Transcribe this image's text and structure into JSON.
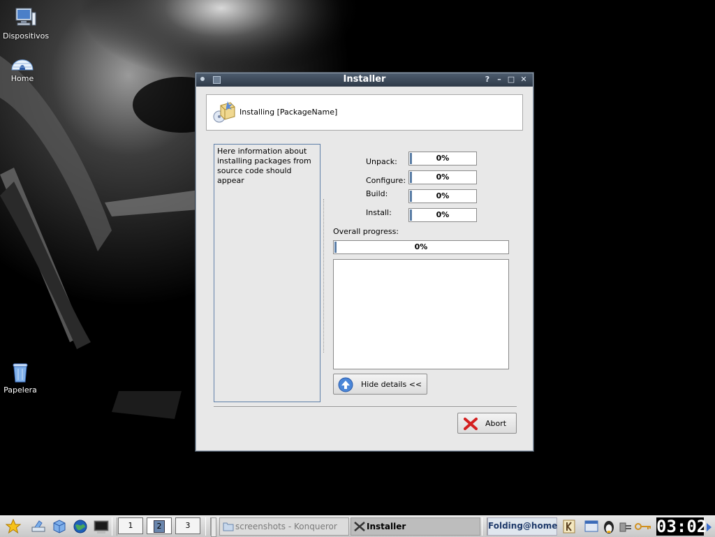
{
  "desktop": {
    "icons": [
      {
        "label": "Dispositivos"
      },
      {
        "label": "Home"
      },
      {
        "label": "Papelera"
      }
    ]
  },
  "window": {
    "title": "Installer",
    "controls": {
      "help": "?",
      "minimize": "–",
      "maximize": "□",
      "close": "✕"
    },
    "header_text": "Installing [PackageName]",
    "info_text": "Here information about installing packages from source code should appear",
    "progress": [
      {
        "label": "Unpack:",
        "value": 0,
        "text": "0%"
      },
      {
        "label": "Configure:",
        "value": 0,
        "text": "0%"
      },
      {
        "label": "Build:",
        "value": 0,
        "text": "0%"
      },
      {
        "label": "Install:",
        "value": 0,
        "text": "0%"
      }
    ],
    "overall": {
      "label": "Overall progress:",
      "value": 0,
      "text": "0%"
    },
    "log_text": "",
    "hide_details_button": "Hide details <<",
    "abort_button": "Abort"
  },
  "taskbar": {
    "pager": [
      "1",
      "2",
      "3"
    ],
    "active_desktop": "2",
    "tasks": [
      {
        "label": "screenshots - Konqueror",
        "active": false
      },
      {
        "label": "Installer",
        "active": true
      }
    ],
    "folding_label": "Folding@home",
    "clock": "03:02"
  },
  "colors": {
    "titlebar": "#3d4a5a",
    "accent": "#5b7ea6",
    "abort_red": "#d42020"
  }
}
